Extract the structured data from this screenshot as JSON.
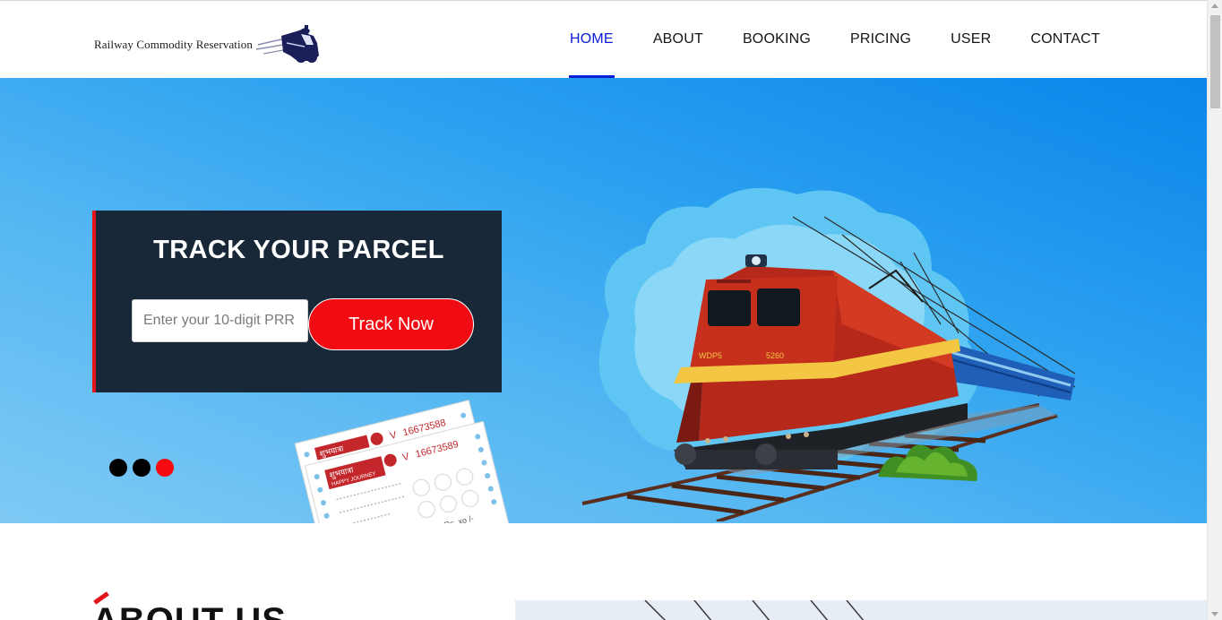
{
  "header": {
    "brand_text": "Railway Commodity Reservation",
    "logo_icon": "steam-locomotive-icon",
    "nav": [
      {
        "label": "HOME",
        "active": true
      },
      {
        "label": "ABOUT",
        "active": false
      },
      {
        "label": "BOOKING",
        "active": false
      },
      {
        "label": "PRICING",
        "active": false
      },
      {
        "label": "USER",
        "active": false
      },
      {
        "label": "CONTACT",
        "active": false
      }
    ]
  },
  "hero": {
    "track": {
      "title": "TRACK YOUR PARCEL",
      "input_placeholder": "Enter your 10-digit PRR",
      "button_label": "Track Now"
    },
    "slider": {
      "count": 3,
      "active_index": 2
    },
    "tickets": {
      "header_text": "शुभयात्रा",
      "subheader_text": "HAPPY JOURNEY",
      "series_back": "V",
      "number_back": "16673588",
      "series_front": "V",
      "number_front": "16673589",
      "fare_text": "Rs. xo /-"
    },
    "train": {
      "loco_label_left": "WDP5",
      "loco_label_right": "5260"
    }
  },
  "about": {
    "title": "ABOUT US"
  },
  "colors": {
    "accent_blue": "#0b1bd6",
    "accent_red": "#f00c12",
    "track_box_bg": "#182838",
    "hero_blue": "#0a86ea"
  }
}
